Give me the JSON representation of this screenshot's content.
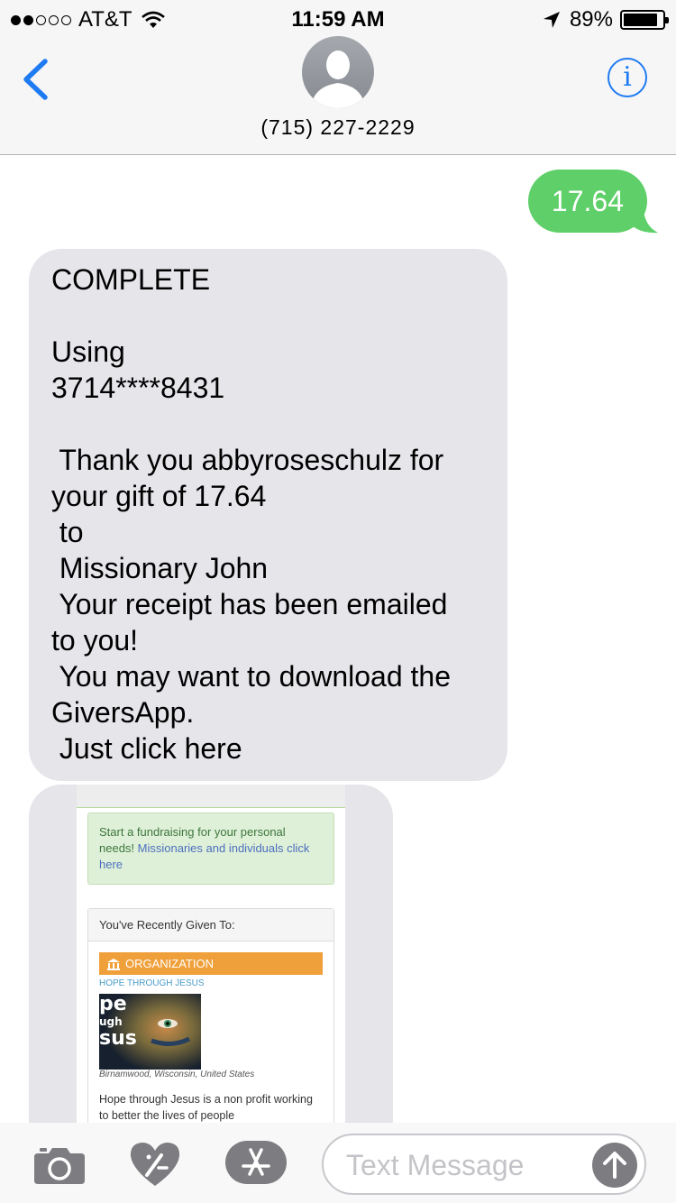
{
  "status_bar": {
    "signal_dots_filled": 2,
    "signal_dots_total": 5,
    "carrier": "AT&T",
    "time": "11:59 AM",
    "battery_percent": "89%",
    "battery_level": 0.89,
    "icons": [
      "wifi-icon",
      "location-arrow-icon",
      "battery-icon"
    ]
  },
  "header": {
    "contact_number": "(715) 227-2229",
    "info_label": "i",
    "icons": [
      "back-chevron-icon",
      "contact-avatar-icon",
      "info-icon"
    ]
  },
  "messages": {
    "outgoing": {
      "text": "17.64",
      "color": "#5fd069"
    },
    "incoming": {
      "lines": [
        "COMPLETE",
        "",
        "Using",
        "3714****8431",
        "",
        " Thank you abbyroseschulz for",
        "your gift of 17.64",
        " to",
        " Missionary John",
        " Your receipt has been emailed",
        "to you!",
        " You may want to download the",
        "GiversApp.",
        " Just click here"
      ],
      "color": "#e5e5ea"
    }
  },
  "preview": {
    "fund_text": "Start a fundraising for your personal needs!",
    "fund_link": "Missionaries and individuals click here",
    "recent_heading": "You've Recently Given To:",
    "org_label": "ORGANIZATION",
    "org_name": "HOPE THROUGH JESUS",
    "org_image_lines": [
      "pe",
      "ugh",
      "sus"
    ],
    "org_location": "Birnamwood, Wisconsin, United States",
    "org_description": "Hope through Jesus is a non profit working to better the lives of people",
    "accent_orange": "#f0a03a",
    "accent_green": "#dff0d8"
  },
  "input_bar": {
    "placeholder": "Text Message",
    "icons": [
      "camera-icon",
      "digital-touch-heart-icon",
      "app-store-icon",
      "send-arrow-icon"
    ]
  },
  "colors": {
    "ios_blue": "#1f7bf2",
    "imessage_green": "#5fd069",
    "bubble_gray": "#e5e5ea"
  }
}
